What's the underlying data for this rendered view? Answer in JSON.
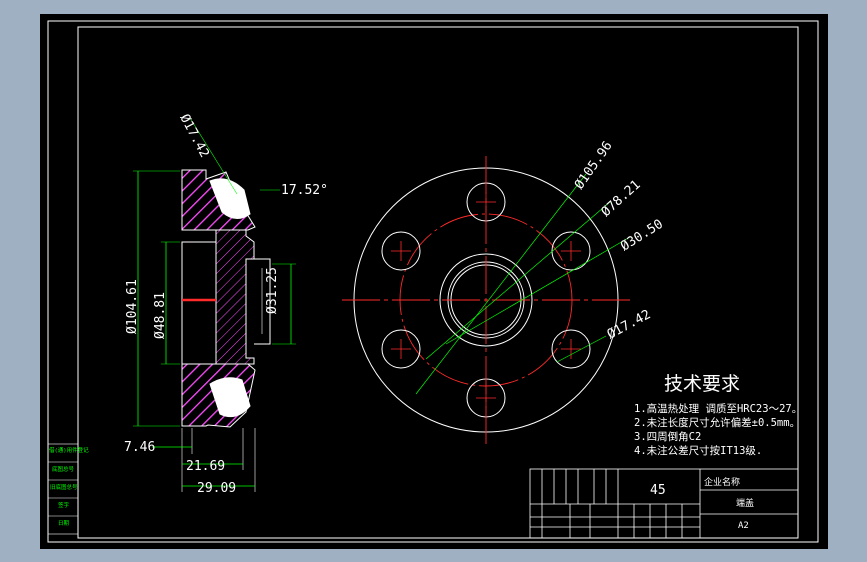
{
  "colors": {
    "background": "#9fb0c2",
    "canvas": "#000000",
    "frame": "#ffffff",
    "dimension": "#ffffff",
    "hatch": "#ff4dff",
    "dim_green": "#00ff00",
    "center_red": "#ff2a2a",
    "hole_circle": "#ffffff"
  },
  "dimensions": {
    "d_hole_side": "Ø17.42",
    "angle": "17.52°",
    "d_outer_side": "Ø104.61",
    "d_inner_side": "Ø48.81",
    "d_bore_side": "Ø31.25",
    "w_746": "7.46",
    "w_2169": "21.69",
    "w_2909": "29.09",
    "d_outer_front": "Ø105.96",
    "d_pcd_front": "Ø78.21",
    "d_bore_front": "Ø30.50",
    "d_hole_front": "Ø17.42"
  },
  "tech_requirements": {
    "title": "技术要求",
    "items": [
      "1.高温热处理 调质至HRC23～27。",
      "2.未注长度尺寸允许偏差±0.5mm。",
      "3.四周倒角C2",
      "4.未注公差尺寸按IT13级."
    ]
  },
  "title_block": {
    "material": "45",
    "company": "企业名称",
    "part_name": "端盖",
    "sheet_size": "A2"
  },
  "left_stamps": [
    "借(通)用件登记",
    "旧底图总号",
    "底图总号",
    "签字",
    "日期"
  ]
}
